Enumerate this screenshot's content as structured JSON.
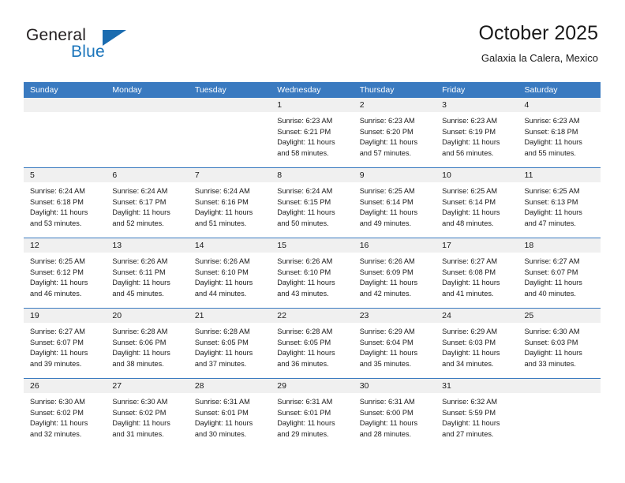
{
  "brand": {
    "word1": "General",
    "word2": "Blue",
    "mark_icon": "triangle-logo-icon",
    "accent_color": "#1b6cb0"
  },
  "header": {
    "title": "October 2025",
    "location": "Galaxia la Calera, Mexico"
  },
  "calendar": {
    "header_bg": "#3a7ac0",
    "daynum_bg": "#f0f0f0",
    "weekday_headers": [
      "Sunday",
      "Monday",
      "Tuesday",
      "Wednesday",
      "Thursday",
      "Friday",
      "Saturday"
    ],
    "weeks": [
      [
        {
          "day": "",
          "lines": []
        },
        {
          "day": "",
          "lines": []
        },
        {
          "day": "",
          "lines": []
        },
        {
          "day": "1",
          "lines": [
            "Sunrise: 6:23 AM",
            "Sunset: 6:21 PM",
            "Daylight: 11 hours",
            "and 58 minutes."
          ]
        },
        {
          "day": "2",
          "lines": [
            "Sunrise: 6:23 AM",
            "Sunset: 6:20 PM",
            "Daylight: 11 hours",
            "and 57 minutes."
          ]
        },
        {
          "day": "3",
          "lines": [
            "Sunrise: 6:23 AM",
            "Sunset: 6:19 PM",
            "Daylight: 11 hours",
            "and 56 minutes."
          ]
        },
        {
          "day": "4",
          "lines": [
            "Sunrise: 6:23 AM",
            "Sunset: 6:18 PM",
            "Daylight: 11 hours",
            "and 55 minutes."
          ]
        }
      ],
      [
        {
          "day": "5",
          "lines": [
            "Sunrise: 6:24 AM",
            "Sunset: 6:18 PM",
            "Daylight: 11 hours",
            "and 53 minutes."
          ]
        },
        {
          "day": "6",
          "lines": [
            "Sunrise: 6:24 AM",
            "Sunset: 6:17 PM",
            "Daylight: 11 hours",
            "and 52 minutes."
          ]
        },
        {
          "day": "7",
          "lines": [
            "Sunrise: 6:24 AM",
            "Sunset: 6:16 PM",
            "Daylight: 11 hours",
            "and 51 minutes."
          ]
        },
        {
          "day": "8",
          "lines": [
            "Sunrise: 6:24 AM",
            "Sunset: 6:15 PM",
            "Daylight: 11 hours",
            "and 50 minutes."
          ]
        },
        {
          "day": "9",
          "lines": [
            "Sunrise: 6:25 AM",
            "Sunset: 6:14 PM",
            "Daylight: 11 hours",
            "and 49 minutes."
          ]
        },
        {
          "day": "10",
          "lines": [
            "Sunrise: 6:25 AM",
            "Sunset: 6:14 PM",
            "Daylight: 11 hours",
            "and 48 minutes."
          ]
        },
        {
          "day": "11",
          "lines": [
            "Sunrise: 6:25 AM",
            "Sunset: 6:13 PM",
            "Daylight: 11 hours",
            "and 47 minutes."
          ]
        }
      ],
      [
        {
          "day": "12",
          "lines": [
            "Sunrise: 6:25 AM",
            "Sunset: 6:12 PM",
            "Daylight: 11 hours",
            "and 46 minutes."
          ]
        },
        {
          "day": "13",
          "lines": [
            "Sunrise: 6:26 AM",
            "Sunset: 6:11 PM",
            "Daylight: 11 hours",
            "and 45 minutes."
          ]
        },
        {
          "day": "14",
          "lines": [
            "Sunrise: 6:26 AM",
            "Sunset: 6:10 PM",
            "Daylight: 11 hours",
            "and 44 minutes."
          ]
        },
        {
          "day": "15",
          "lines": [
            "Sunrise: 6:26 AM",
            "Sunset: 6:10 PM",
            "Daylight: 11 hours",
            "and 43 minutes."
          ]
        },
        {
          "day": "16",
          "lines": [
            "Sunrise: 6:26 AM",
            "Sunset: 6:09 PM",
            "Daylight: 11 hours",
            "and 42 minutes."
          ]
        },
        {
          "day": "17",
          "lines": [
            "Sunrise: 6:27 AM",
            "Sunset: 6:08 PM",
            "Daylight: 11 hours",
            "and 41 minutes."
          ]
        },
        {
          "day": "18",
          "lines": [
            "Sunrise: 6:27 AM",
            "Sunset: 6:07 PM",
            "Daylight: 11 hours",
            "and 40 minutes."
          ]
        }
      ],
      [
        {
          "day": "19",
          "lines": [
            "Sunrise: 6:27 AM",
            "Sunset: 6:07 PM",
            "Daylight: 11 hours",
            "and 39 minutes."
          ]
        },
        {
          "day": "20",
          "lines": [
            "Sunrise: 6:28 AM",
            "Sunset: 6:06 PM",
            "Daylight: 11 hours",
            "and 38 minutes."
          ]
        },
        {
          "day": "21",
          "lines": [
            "Sunrise: 6:28 AM",
            "Sunset: 6:05 PM",
            "Daylight: 11 hours",
            "and 37 minutes."
          ]
        },
        {
          "day": "22",
          "lines": [
            "Sunrise: 6:28 AM",
            "Sunset: 6:05 PM",
            "Daylight: 11 hours",
            "and 36 minutes."
          ]
        },
        {
          "day": "23",
          "lines": [
            "Sunrise: 6:29 AM",
            "Sunset: 6:04 PM",
            "Daylight: 11 hours",
            "and 35 minutes."
          ]
        },
        {
          "day": "24",
          "lines": [
            "Sunrise: 6:29 AM",
            "Sunset: 6:03 PM",
            "Daylight: 11 hours",
            "and 34 minutes."
          ]
        },
        {
          "day": "25",
          "lines": [
            "Sunrise: 6:30 AM",
            "Sunset: 6:03 PM",
            "Daylight: 11 hours",
            "and 33 minutes."
          ]
        }
      ],
      [
        {
          "day": "26",
          "lines": [
            "Sunrise: 6:30 AM",
            "Sunset: 6:02 PM",
            "Daylight: 11 hours",
            "and 32 minutes."
          ]
        },
        {
          "day": "27",
          "lines": [
            "Sunrise: 6:30 AM",
            "Sunset: 6:02 PM",
            "Daylight: 11 hours",
            "and 31 minutes."
          ]
        },
        {
          "day": "28",
          "lines": [
            "Sunrise: 6:31 AM",
            "Sunset: 6:01 PM",
            "Daylight: 11 hours",
            "and 30 minutes."
          ]
        },
        {
          "day": "29",
          "lines": [
            "Sunrise: 6:31 AM",
            "Sunset: 6:01 PM",
            "Daylight: 11 hours",
            "and 29 minutes."
          ]
        },
        {
          "day": "30",
          "lines": [
            "Sunrise: 6:31 AM",
            "Sunset: 6:00 PM",
            "Daylight: 11 hours",
            "and 28 minutes."
          ]
        },
        {
          "day": "31",
          "lines": [
            "Sunrise: 6:32 AM",
            "Sunset: 5:59 PM",
            "Daylight: 11 hours",
            "and 27 minutes."
          ]
        },
        {
          "day": "",
          "lines": []
        }
      ]
    ]
  }
}
